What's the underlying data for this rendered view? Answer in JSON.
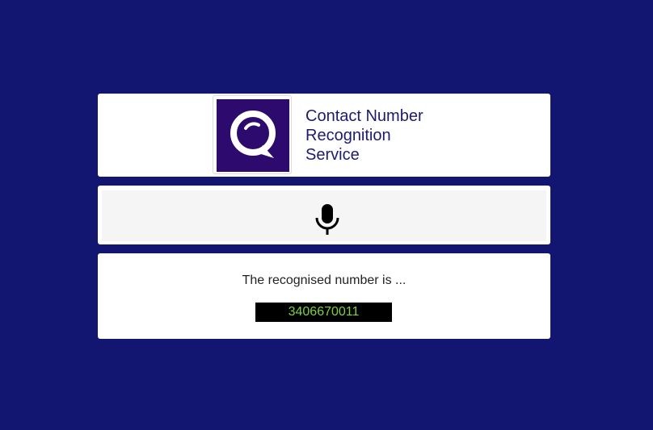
{
  "header": {
    "logo_icon": "speech-bubble-search-icon",
    "title_line1": "Contact Number",
    "title_line2": "Recognition",
    "title_line3": "Service"
  },
  "mic": {
    "icon": "microphone-icon"
  },
  "result": {
    "label": "The recognised number is ...",
    "value": "3406670011"
  },
  "colors": {
    "background": "#121670",
    "logo_bg": "#2c0a6e",
    "title": "#1c1c6e",
    "result_text": "#7fd13b",
    "result_bg": "#000000"
  }
}
